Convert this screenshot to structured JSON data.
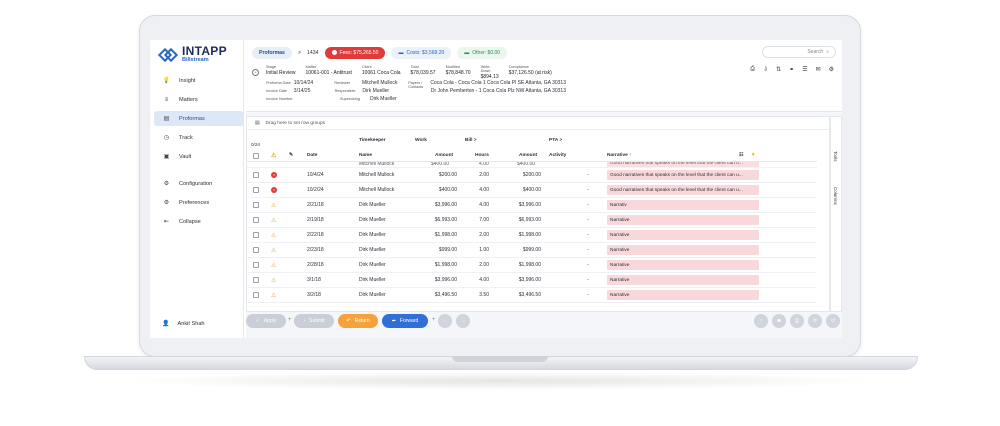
{
  "brand": {
    "name": "INTAPP",
    "product": "Billstream"
  },
  "sidebar": {
    "items": [
      {
        "label": "Insight",
        "icon": "lightbulb-icon",
        "glyph": "💡",
        "active": false
      },
      {
        "label": "Matters",
        "icon": "stack-icon",
        "glyph": "≡",
        "active": false
      },
      {
        "label": "Proformas",
        "icon": "document-icon",
        "glyph": "▤",
        "active": true
      },
      {
        "label": "Track",
        "icon": "clock-icon",
        "glyph": "◷",
        "active": false
      },
      {
        "label": "Vault",
        "icon": "vault-icon",
        "glyph": "▣",
        "active": false
      }
    ],
    "settings": [
      {
        "label": "Configuration",
        "icon": "gear-icon",
        "glyph": "⚙"
      },
      {
        "label": "Preferences",
        "icon": "sliders-icon",
        "glyph": "⚙"
      },
      {
        "label": "Collapse",
        "icon": "collapse-icon",
        "glyph": "⇤"
      }
    ],
    "user": {
      "name": "Ankit Shah",
      "icon": "user-icon",
      "glyph": "👤"
    }
  },
  "topbar": {
    "breadcrumb": {
      "section": "Proformas",
      "sep": ">",
      "id": "1434"
    },
    "fees": "Fees: $75,265.50",
    "costs": "Costs: $3,568.20",
    "other": "Other: $0.00",
    "search_placeholder": "Search"
  },
  "header": {
    "cols": [
      {
        "label": "Stage",
        "value": "Initial Review"
      },
      {
        "label": "Matter",
        "value": "10061-001 - Antitrust"
      },
      {
        "label": "Client",
        "value": "10061 Coca Cola"
      },
      {
        "label": "Total",
        "value": "$78,039.57"
      },
      {
        "label": "Modified",
        "value": "$78,848.70"
      },
      {
        "label": "Write-Down",
        "value": "$894.13"
      },
      {
        "label": "Compliance",
        "value": "$37,126.50 (at risk)"
      }
    ],
    "rows": [
      {
        "l1": "Proforma Date",
        "v1": "10/14/24",
        "l2": "Reviewer",
        "v2": "Mitchell Mullock",
        "l3": "Payers / Contacts",
        "v3": "Coca Cola - Coca Cola 1 Coca Cola Pl SE Atlanta, GA 30313"
      },
      {
        "l1": "Invoice Date",
        "v1": "3/14/25",
        "l2": "Responsible",
        "v2": "Dirk Mueller",
        "l3": "",
        "v3": "Dr John Pemberton - 1 Coca Cola Plz NW Atlanta, GA 30313"
      },
      {
        "l1": "Invoice Number",
        "v1": "",
        "l2": "Supervising",
        "v2": "Dirk Mueller",
        "l3": "",
        "v3": ""
      }
    ]
  },
  "grid": {
    "group_hint": "Drag here to set row groups",
    "count": "0/24",
    "groups": {
      "timekeeper": "Timekeeper",
      "work": "Work",
      "bill": "Bill >",
      "pta": "PTA >"
    },
    "columns": {
      "date": "Date",
      "name": "Name",
      "amount": "Amount",
      "hours": "Hours",
      "bill_amount": "Amount",
      "activity": "Activity",
      "narrative": "Narrative ↑"
    },
    "partial_row": {
      "name": "Mitchell Mullock",
      "amount": "$400.00",
      "hours": "4.00",
      "bill_amount": "$400.00",
      "narrative": "Good narratives that speaks on the level that the client can u..."
    },
    "rows": [
      {
        "status": "error",
        "date": "10/4/24",
        "name": "Mitchell Mullock",
        "amount": "$200.00",
        "hours": "2.00",
        "bill_amount": "$200.00",
        "activity": "-",
        "narrative": "Good narratives that speaks on the level that the client can u..."
      },
      {
        "status": "error",
        "date": "10/2/24",
        "name": "Mitchell Mullock",
        "amount": "$400.00",
        "hours": "4.00",
        "bill_amount": "$400.00",
        "activity": "-",
        "narrative": "Good narratives that speaks on the level that the client can u..."
      },
      {
        "status": "warn",
        "date": "2/21/18",
        "name": "Dirk Mueller",
        "amount": "$3,996.00",
        "hours": "4.00",
        "bill_amount": "$3,996.00",
        "activity": "-",
        "narrative": "Narrativ"
      },
      {
        "status": "warn",
        "date": "2/19/18",
        "name": "Dirk Mueller",
        "amount": "$6,993.00",
        "hours": "7.00",
        "bill_amount": "$6,993.00",
        "activity": "-",
        "narrative": "Narrative"
      },
      {
        "status": "warn",
        "date": "2/22/18",
        "name": "Dirk Mueller",
        "amount": "$1,998.00",
        "hours": "2.00",
        "bill_amount": "$1,998.00",
        "activity": "-",
        "narrative": "Narrative"
      },
      {
        "status": "warn",
        "date": "2/23/18",
        "name": "Dirk Mueller",
        "amount": "$999.00",
        "hours": "1.00",
        "bill_amount": "$999.00",
        "activity": "-",
        "narrative": "Narrative"
      },
      {
        "status": "warn",
        "date": "2/28/18",
        "name": "Dirk Mueller",
        "amount": "$1,998.00",
        "hours": "2.00",
        "bill_amount": "$1,998.00",
        "activity": "-",
        "narrative": "Narrative"
      },
      {
        "status": "warn",
        "date": "3/1/18",
        "name": "Dirk Mueller",
        "amount": "$3,996.00",
        "hours": "4.00",
        "bill_amount": "$3,996.00",
        "activity": "-",
        "narrative": "Narrative"
      },
      {
        "status": "warn",
        "date": "3/2/18",
        "name": "Dirk Mueller",
        "amount": "$3,496.50",
        "hours": "3.50",
        "bill_amount": "$3,496.50",
        "activity": "-",
        "narrative": "Narrative"
      }
    ],
    "rail": {
      "tools": "Tools",
      "columns": "Columns"
    }
  },
  "footer": {
    "apply": "Apply",
    "submit": "Submit",
    "return": "Return",
    "forward": "Forward"
  },
  "colors": {
    "accent": "#2f6fd6",
    "fees": "#e03b3b",
    "return": "#f5a23c",
    "narrative_bg": "#f8d8da"
  }
}
